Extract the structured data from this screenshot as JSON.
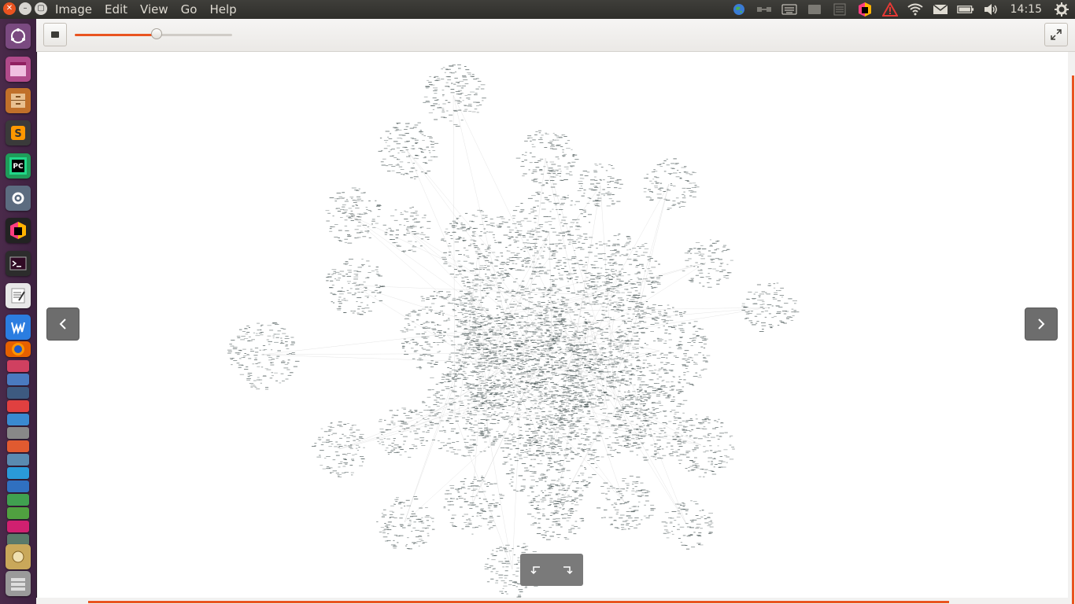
{
  "menu": [
    "Image",
    "Edit",
    "View",
    "Go",
    "Help"
  ],
  "tray": {
    "clock": "14:15",
    "icons": [
      "globe-icon",
      "network-applet-icon",
      "keyboard-icon",
      "screen-icon",
      "notes-icon",
      "jetbrains-toolbox-icon",
      "warning-icon",
      "wifi-icon",
      "mail-icon",
      "battery-icon",
      "volume-icon",
      "settings-gear-icon"
    ]
  },
  "window_controls": [
    "close",
    "minimize",
    "maximize"
  ],
  "launcher": [
    "dash-home",
    "files-window",
    "file-cabinet",
    "sublime-text",
    "pycharm",
    "system-settings",
    "jetbrains-toolbox",
    "terminal",
    "text-editor",
    "wps-writer",
    "firefox",
    "stacked-apps"
  ],
  "zoom": {
    "level": 0.52
  },
  "viewer": {
    "image_type": "network-graph",
    "prev_icon": "chevron-left-icon",
    "next_icon": "chevron-right-icon",
    "rotate_left_icon": "rotate-left-icon",
    "rotate_right_icon": "rotate-right-icon"
  },
  "colors": {
    "accent": "#e95420",
    "panel": "#3c3b37",
    "launcher": "#3d2140",
    "node": "#4d5a5a",
    "edge": "#c8c8c8"
  }
}
